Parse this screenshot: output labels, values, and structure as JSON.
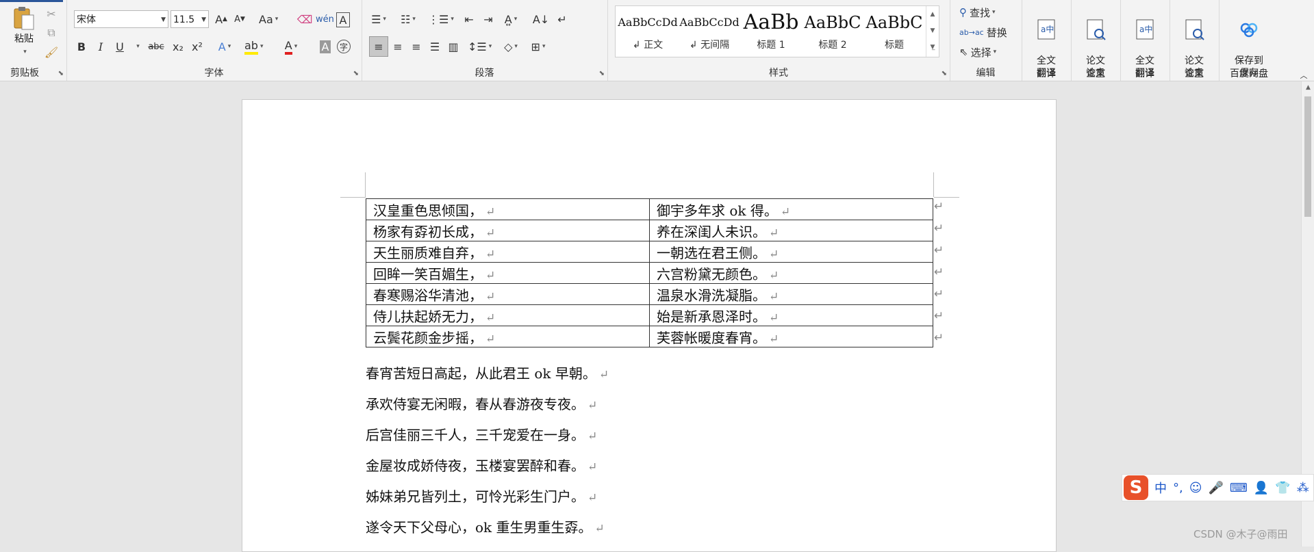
{
  "ribbon": {
    "clipboard": {
      "label": "剪贴板",
      "paste_label": "粘贴"
    },
    "font": {
      "label": "字体",
      "font_name": "宋体",
      "font_size": "11.5",
      "bold": "B",
      "italic": "I",
      "underline": "U",
      "strike": "abc",
      "sub": "x₂",
      "sup": "x²",
      "case": "Aa",
      "grow": "A",
      "shrink": "A"
    },
    "paragraph": {
      "label": "段落"
    },
    "styles": {
      "label": "样式",
      "items": [
        {
          "sample": "AaBbCcDd",
          "name": "↲ 正文"
        },
        {
          "sample": "AaBbCcDd",
          "name": "↲ 无间隔"
        },
        {
          "sample": "AaBb",
          "name": "标题 1"
        },
        {
          "sample": "AaBbC",
          "name": "标题 2"
        },
        {
          "sample": "AaBbC",
          "name": "标题"
        }
      ]
    },
    "editing": {
      "label": "编辑",
      "find": "查找",
      "replace": "替换",
      "select": "选择"
    },
    "translate1": {
      "title": "全文\n翻译",
      "label": "翻译"
    },
    "paper1": {
      "title": "论文\n查重",
      "label": "论文"
    },
    "translate2": {
      "title": "全文\n翻译",
      "label": "翻译"
    },
    "paper2": {
      "title": "论文\n查重",
      "label": "论文"
    },
    "save": {
      "title": "保存到\n百度网盘",
      "label": "保存"
    }
  },
  "document": {
    "table_rows": [
      [
        "汉皇重色思倾国，",
        "御宇多年求 ok 得。"
      ],
      [
        "杨家有孬初长成，",
        "养在深闺人未识。"
      ],
      [
        "天生丽质难自弃，",
        "一朝选在君王侧。"
      ],
      [
        "回眸一笑百媚生，",
        "六宫粉黛无颜色。"
      ],
      [
        "春寒赐浴华清池，",
        "温泉水滑洗凝脂。"
      ],
      [
        "侍儿扶起娇无力，",
        "始是新承恩泽时。"
      ],
      [
        "云鬓花颜金步摇，",
        "芙蓉帐暖度春宵。"
      ]
    ],
    "lines": [
      "春宵苦短日高起，从此君王 ok 早朝。",
      "承欢侍宴无闲暇，春从春游夜专夜。",
      "后宫佳丽三千人，三千宠爱在一身。",
      "金屋妆成娇侍夜，玉楼宴罢醉和春。",
      "姊妹弟兄皆列土，可怜光彩生门户。",
      "遂令天下父母心，ok 重生男重生孬。"
    ],
    "para_mark": "↵"
  },
  "ime": {
    "lang": "中"
  },
  "watermark": "CSDN @木子@雨田"
}
